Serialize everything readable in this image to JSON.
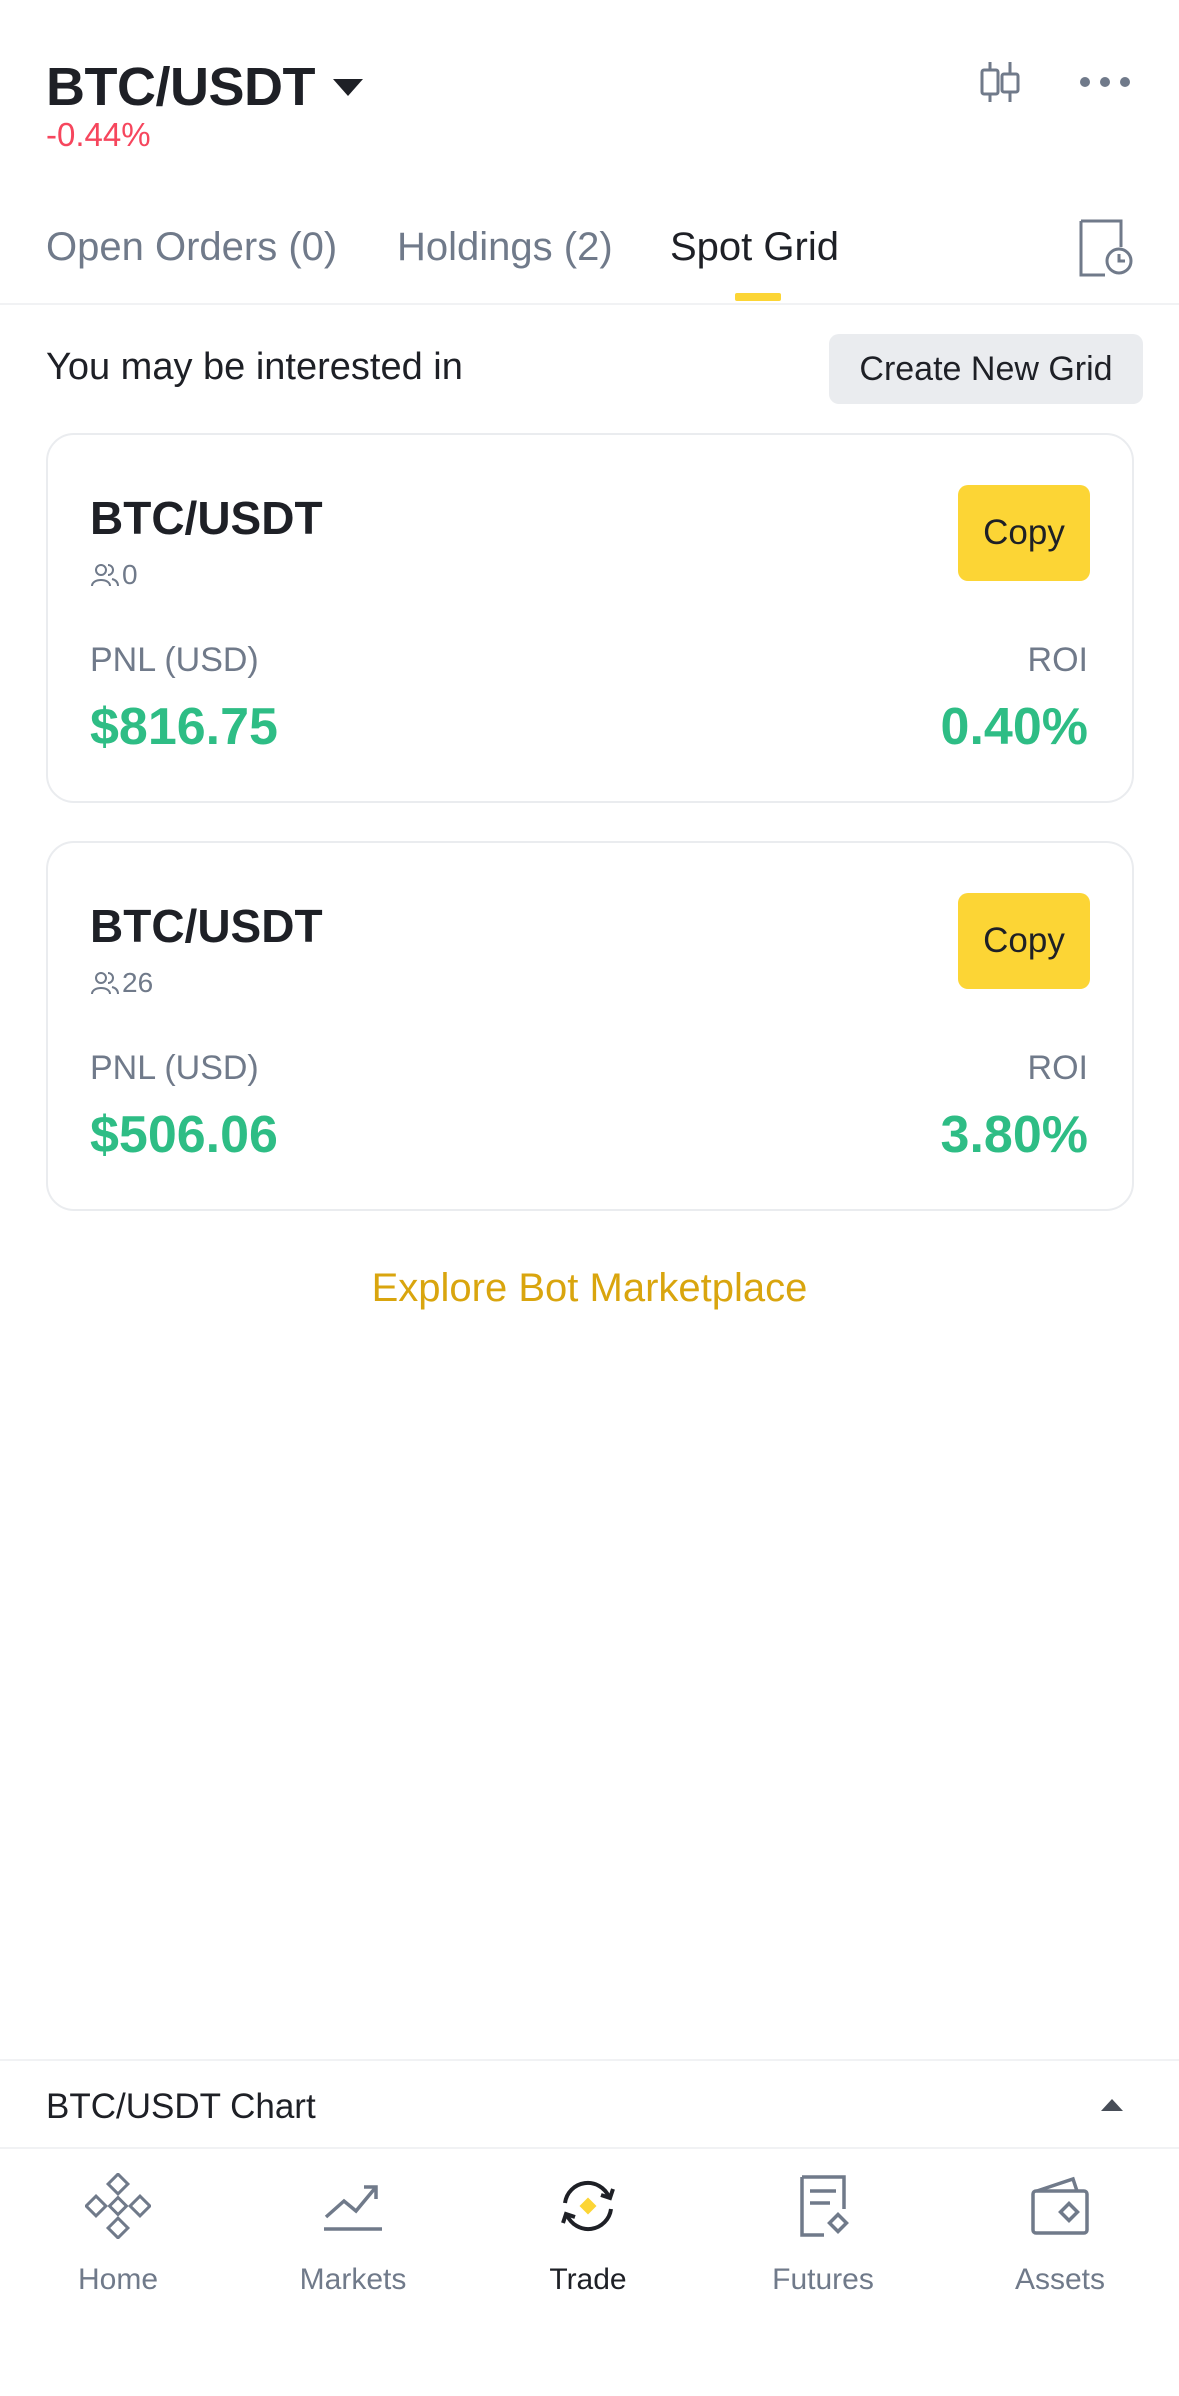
{
  "header": {
    "pair": "BTC/USDT",
    "change": "-0.44%"
  },
  "tabs": [
    {
      "label": "Open Orders (0)"
    },
    {
      "label": "Holdings (2)"
    },
    {
      "label": "Spot Grid"
    }
  ],
  "interest": {
    "label": "You may be interested in",
    "create_button": "Create New Grid"
  },
  "cards": [
    {
      "pair": "BTC/USDT",
      "users": "0",
      "copy_label": "Copy",
      "pnl_label": "PNL (USD)",
      "pnl": "$816.75",
      "roi_label": "ROI",
      "roi": "0.40%"
    },
    {
      "pair": "BTC/USDT",
      "users": "26",
      "copy_label": "Copy",
      "pnl_label": "PNL (USD)",
      "pnl": "$506.06",
      "roi_label": "ROI",
      "roi": "3.80%"
    }
  ],
  "explore_link": "Explore Bot Marketplace",
  "chart_bar": {
    "label": "BTC/USDT Chart"
  },
  "nav": [
    {
      "label": "Home",
      "icon": "home-icon"
    },
    {
      "label": "Markets",
      "icon": "markets-icon"
    },
    {
      "label": "Trade",
      "icon": "trade-icon"
    },
    {
      "label": "Futures",
      "icon": "futures-icon"
    },
    {
      "label": "Assets",
      "icon": "assets-icon"
    }
  ],
  "colors": {
    "accent": "#fcd535",
    "positive": "#2ebd85",
    "negative": "#f6465d",
    "link": "#d9a50e"
  }
}
